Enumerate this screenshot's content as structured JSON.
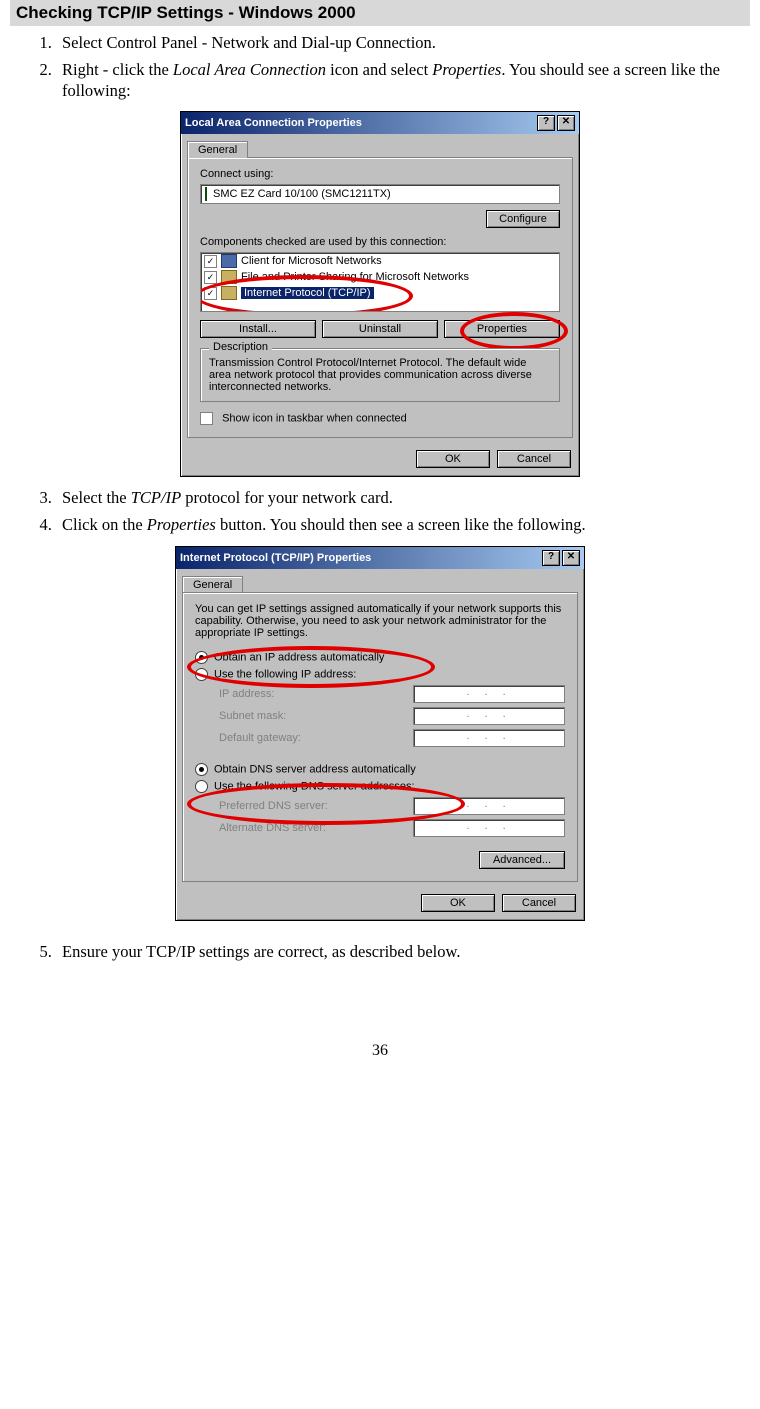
{
  "heading": "Checking TCP/IP Settings - Windows 2000",
  "steps": {
    "s1": "Select Control Panel - Network and Dial-up Connection.",
    "s2_a": "Right - click the ",
    "s2_i1": "Local Area Connection",
    "s2_b": " icon and select ",
    "s2_i2": "Properties",
    "s2_c": ". You should see a screen like the following:",
    "s3_a": "Select the ",
    "s3_i1": "TCP/IP",
    "s3_b": " protocol for your network card.",
    "s4_a": "Click on the ",
    "s4_i1": "Properties",
    "s4_b": " button. You should then see a screen like the following.",
    "s5": "Ensure your TCP/IP settings are correct, as described below."
  },
  "dlg1": {
    "title": "Local Area Connection Properties",
    "help_btn": "?",
    "close_btn": "✕",
    "tab_general": "General",
    "connect_using": "Connect using:",
    "nic": "SMC EZ Card 10/100 (SMC1211TX)",
    "configure": "Configure",
    "components_label": "Components checked are used by this connection:",
    "comp1": "Client for Microsoft Networks",
    "comp2": "File and Printer Sharing for Microsoft Networks",
    "comp3": "Internet Protocol (TCP/IP)",
    "check": "✓",
    "install": "Install...",
    "uninstall": "Uninstall",
    "properties": "Properties",
    "desc_title": "Description",
    "desc_text": "Transmission Control Protocol/Internet Protocol. The default wide area network protocol that provides communication across diverse interconnected networks.",
    "show_icon": "Show icon in taskbar when connected",
    "ok": "OK",
    "cancel": "Cancel"
  },
  "dlg2": {
    "title": "Internet Protocol (TCP/IP) Properties",
    "help_btn": "?",
    "close_btn": "✕",
    "tab_general": "General",
    "intro": "You can get IP settings assigned automatically if your network supports this capability. Otherwise, you need to ask your network administrator for the appropriate IP settings.",
    "r_ip_auto": "Obtain an IP address automatically",
    "r_ip_manual": "Use the following IP address:",
    "ip_address": "IP address:",
    "subnet": "Subnet mask:",
    "gateway": "Default gateway:",
    "r_dns_auto": "Obtain DNS server address automatically",
    "r_dns_manual": "Use the following DNS server addresses:",
    "pref_dns": "Preferred DNS server:",
    "alt_dns": "Alternate DNS server:",
    "dots": ".       .       .",
    "advanced": "Advanced...",
    "ok": "OK",
    "cancel": "Cancel"
  },
  "page_number": "36"
}
